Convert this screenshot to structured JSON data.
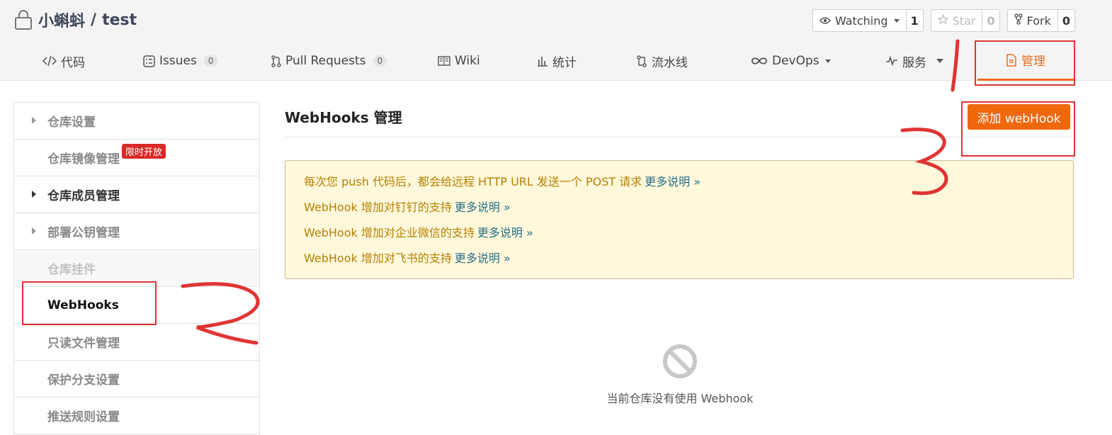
{
  "repo": {
    "owner": "小蝌蚪",
    "separator": "/",
    "name": "test"
  },
  "actions": {
    "watch": {
      "label": "Watching",
      "count": "1"
    },
    "star": {
      "label": "Star",
      "count": "0"
    },
    "fork": {
      "label": "Fork",
      "count": "0"
    }
  },
  "tabs": [
    {
      "label": "代码"
    },
    {
      "label": "Issues",
      "badge": "0"
    },
    {
      "label": "Pull Requests",
      "badge": "0"
    },
    {
      "label": "Wiki"
    },
    {
      "label": "统计"
    },
    {
      "label": "流水线"
    },
    {
      "label": "DevOps"
    },
    {
      "label": "服务"
    },
    {
      "label": "管理"
    }
  ],
  "sidebar": {
    "items": [
      {
        "label": "仓库设置"
      },
      {
        "label": "仓库镜像管理",
        "badge": "限时开放"
      },
      {
        "label": "仓库成员管理"
      },
      {
        "label": "部署公钥管理"
      },
      {
        "label": "仓库挂件"
      },
      {
        "label": "WebHooks"
      },
      {
        "label": "只读文件管理"
      },
      {
        "label": "保护分支设置"
      },
      {
        "label": "推送规则设置"
      }
    ]
  },
  "main": {
    "title": "WebHooks 管理",
    "add_button": "添加 webHook",
    "notices": [
      {
        "text": "每次您 push 代码后，都会给远程 HTTP URL 发送一个 POST 请求",
        "link": "更多说明 »"
      },
      {
        "text": "WebHook 增加对钉钉的支持",
        "link": "更多说明 »"
      },
      {
        "text": "WebHook 增加对企业微信的支持",
        "link": "更多说明 »"
      },
      {
        "text": "WebHook 增加对飞书的支持",
        "link": "更多说明 »"
      }
    ],
    "empty_text": "当前仓库没有使用 Webhook"
  },
  "colors": {
    "accent": "#f06c1b",
    "button": "#f0680e",
    "annotation": "#e03434",
    "notice_bg": "#fff8db"
  }
}
